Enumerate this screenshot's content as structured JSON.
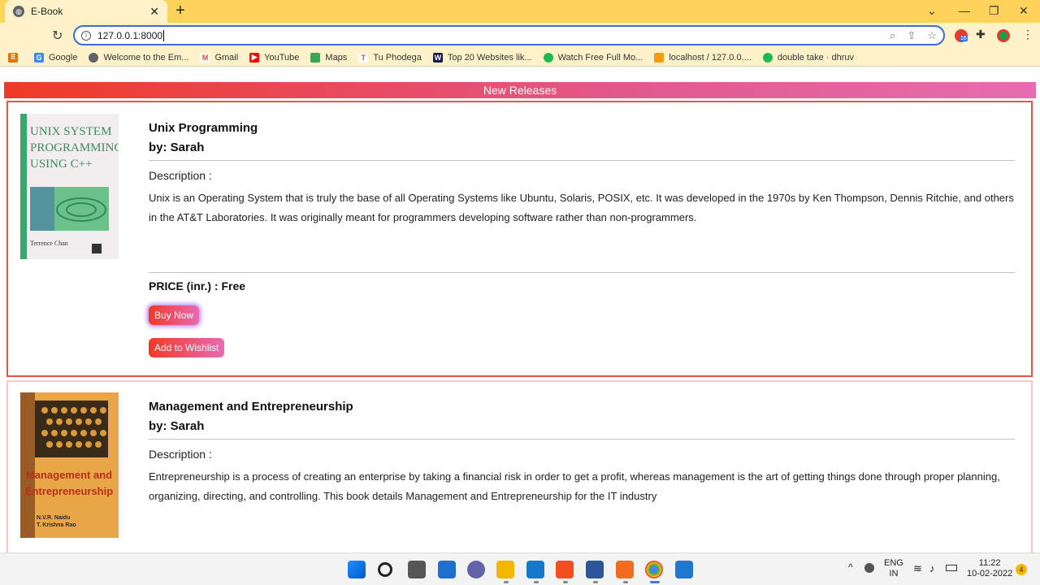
{
  "browser": {
    "tab_title": "E-Book",
    "url": "127.0.0.1:8000",
    "bookmarks": [
      {
        "label": "Google",
        "icon": "google-icon",
        "color": "#4285f4"
      },
      {
        "label": "Welcome to the Em...",
        "icon": "globe-icon",
        "color": "#5f6368"
      },
      {
        "label": "Gmail",
        "icon": "gmail-icon",
        "color": "#ea4335"
      },
      {
        "label": "YouTube",
        "icon": "youtube-icon",
        "color": "#ff0000"
      },
      {
        "label": "Maps",
        "icon": "maps-icon",
        "color": "#34a853"
      },
      {
        "label": "Tu Phodega",
        "icon": "tu-phodega-icon",
        "color": "#e8482e"
      },
      {
        "label": "Top 20 Websites lik...",
        "icon": "w-icon",
        "color": "#1a1a4a"
      },
      {
        "label": "Watch Free Full Mo...",
        "icon": "watch-icon",
        "color": "#1db954"
      },
      {
        "label": "localhost / 127.0.0....",
        "icon": "phpmyadmin-icon",
        "color": "#f89c0e"
      },
      {
        "label": "double take · dhruv",
        "icon": "spotify-icon",
        "color": "#1db954"
      }
    ]
  },
  "page": {
    "section_title": "New Releases",
    "books": [
      {
        "title": "Unix Programming",
        "author": "by: Sarah",
        "description_label": "Description :",
        "description": "Unix is an Operating System that is truly the base of all Operating Systems like Ubuntu, Solaris, POSIX, etc. It was developed in the 1970s by Ken Thompson, Dennis Ritchie, and others in the AT&T Laboratories. It was originally meant for programmers developing software rather than non-programmers.",
        "price": "PRICE (inr.) : Free",
        "buy_label": "Buy Now",
        "wishlist_label": "Add to Wishlist",
        "cover": {
          "line1": "UNIX SYSTEM",
          "line2": "PROGRAMMING",
          "line3": "USING C++",
          "author": "Terrence Chan"
        }
      },
      {
        "title": "Management and Entrepreneurship",
        "author": "by: Sarah",
        "description_label": "Description :",
        "description": "Entrepreneurship is a process of creating an enterprise by taking a financial risk in order to get a profit, whereas management is the art of getting things done through proper planning, organizing, directing, and controlling. This book details Management and Entrepreneurship for the IT industry",
        "cover": {
          "line1": "Management and",
          "line2": "Entrepreneurship",
          "author1": "N.V.R. Naidu",
          "author2": "T. Krishna Rao"
        }
      }
    ]
  },
  "taskbar": {
    "lang": "ENG",
    "region": "IN",
    "time": "11:22",
    "date": "10-02-2022",
    "notifications": "4",
    "ext_badge": "16"
  }
}
